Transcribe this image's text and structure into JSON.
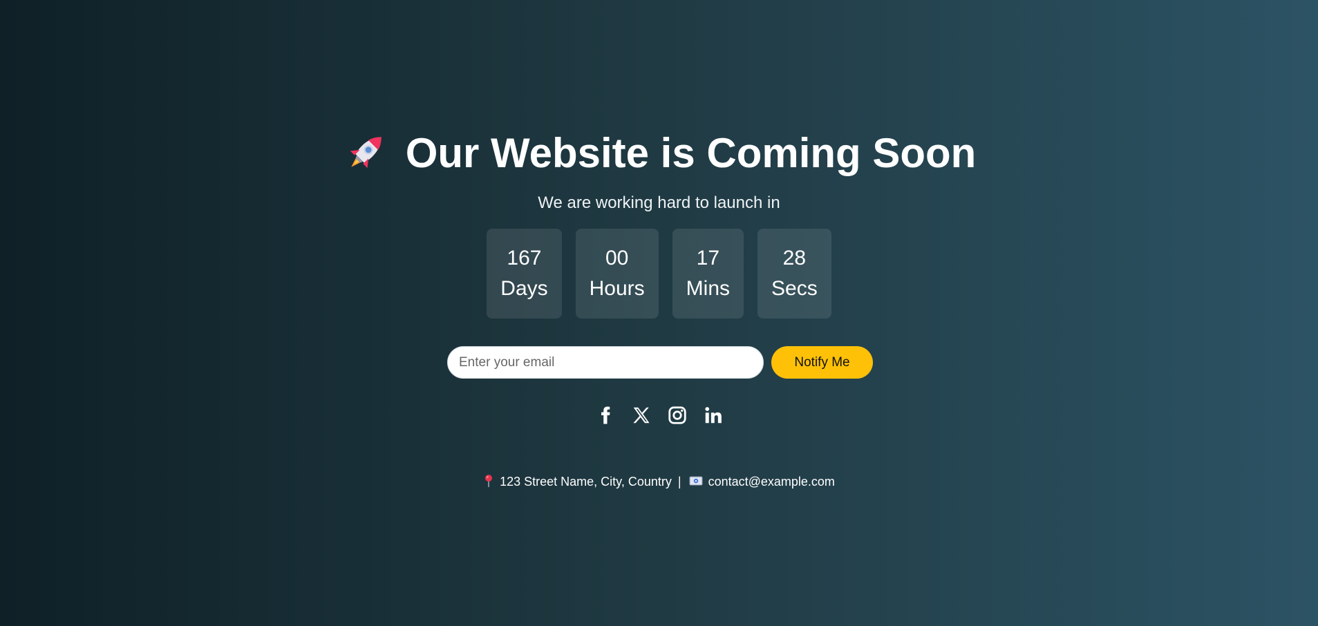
{
  "header": {
    "title": "Our Website is Coming Soon",
    "subtitle": "We are working hard to launch in",
    "icon": "rocket-icon"
  },
  "countdown": [
    {
      "value": "167",
      "label": "Days"
    },
    {
      "value": "00",
      "label": "Hours"
    },
    {
      "value": "17",
      "label": "Mins"
    },
    {
      "value": "28",
      "label": "Secs"
    }
  ],
  "subscribe": {
    "placeholder": "Enter your email",
    "value": "",
    "button_label": "Notify Me"
  },
  "social": [
    {
      "icon": "facebook-icon"
    },
    {
      "icon": "x-twitter-icon"
    },
    {
      "icon": "instagram-icon"
    },
    {
      "icon": "linkedin-icon"
    }
  ],
  "footer": {
    "address": "123 Street Name, City, Country",
    "separator": "|",
    "email": "contact@example.com",
    "address_icon": "pin-icon",
    "email_icon": "email-icon"
  },
  "colors": {
    "background_start": "#0f2027",
    "background_end": "#2c5364",
    "accent": "#ffc107",
    "text": "#ffffff"
  }
}
